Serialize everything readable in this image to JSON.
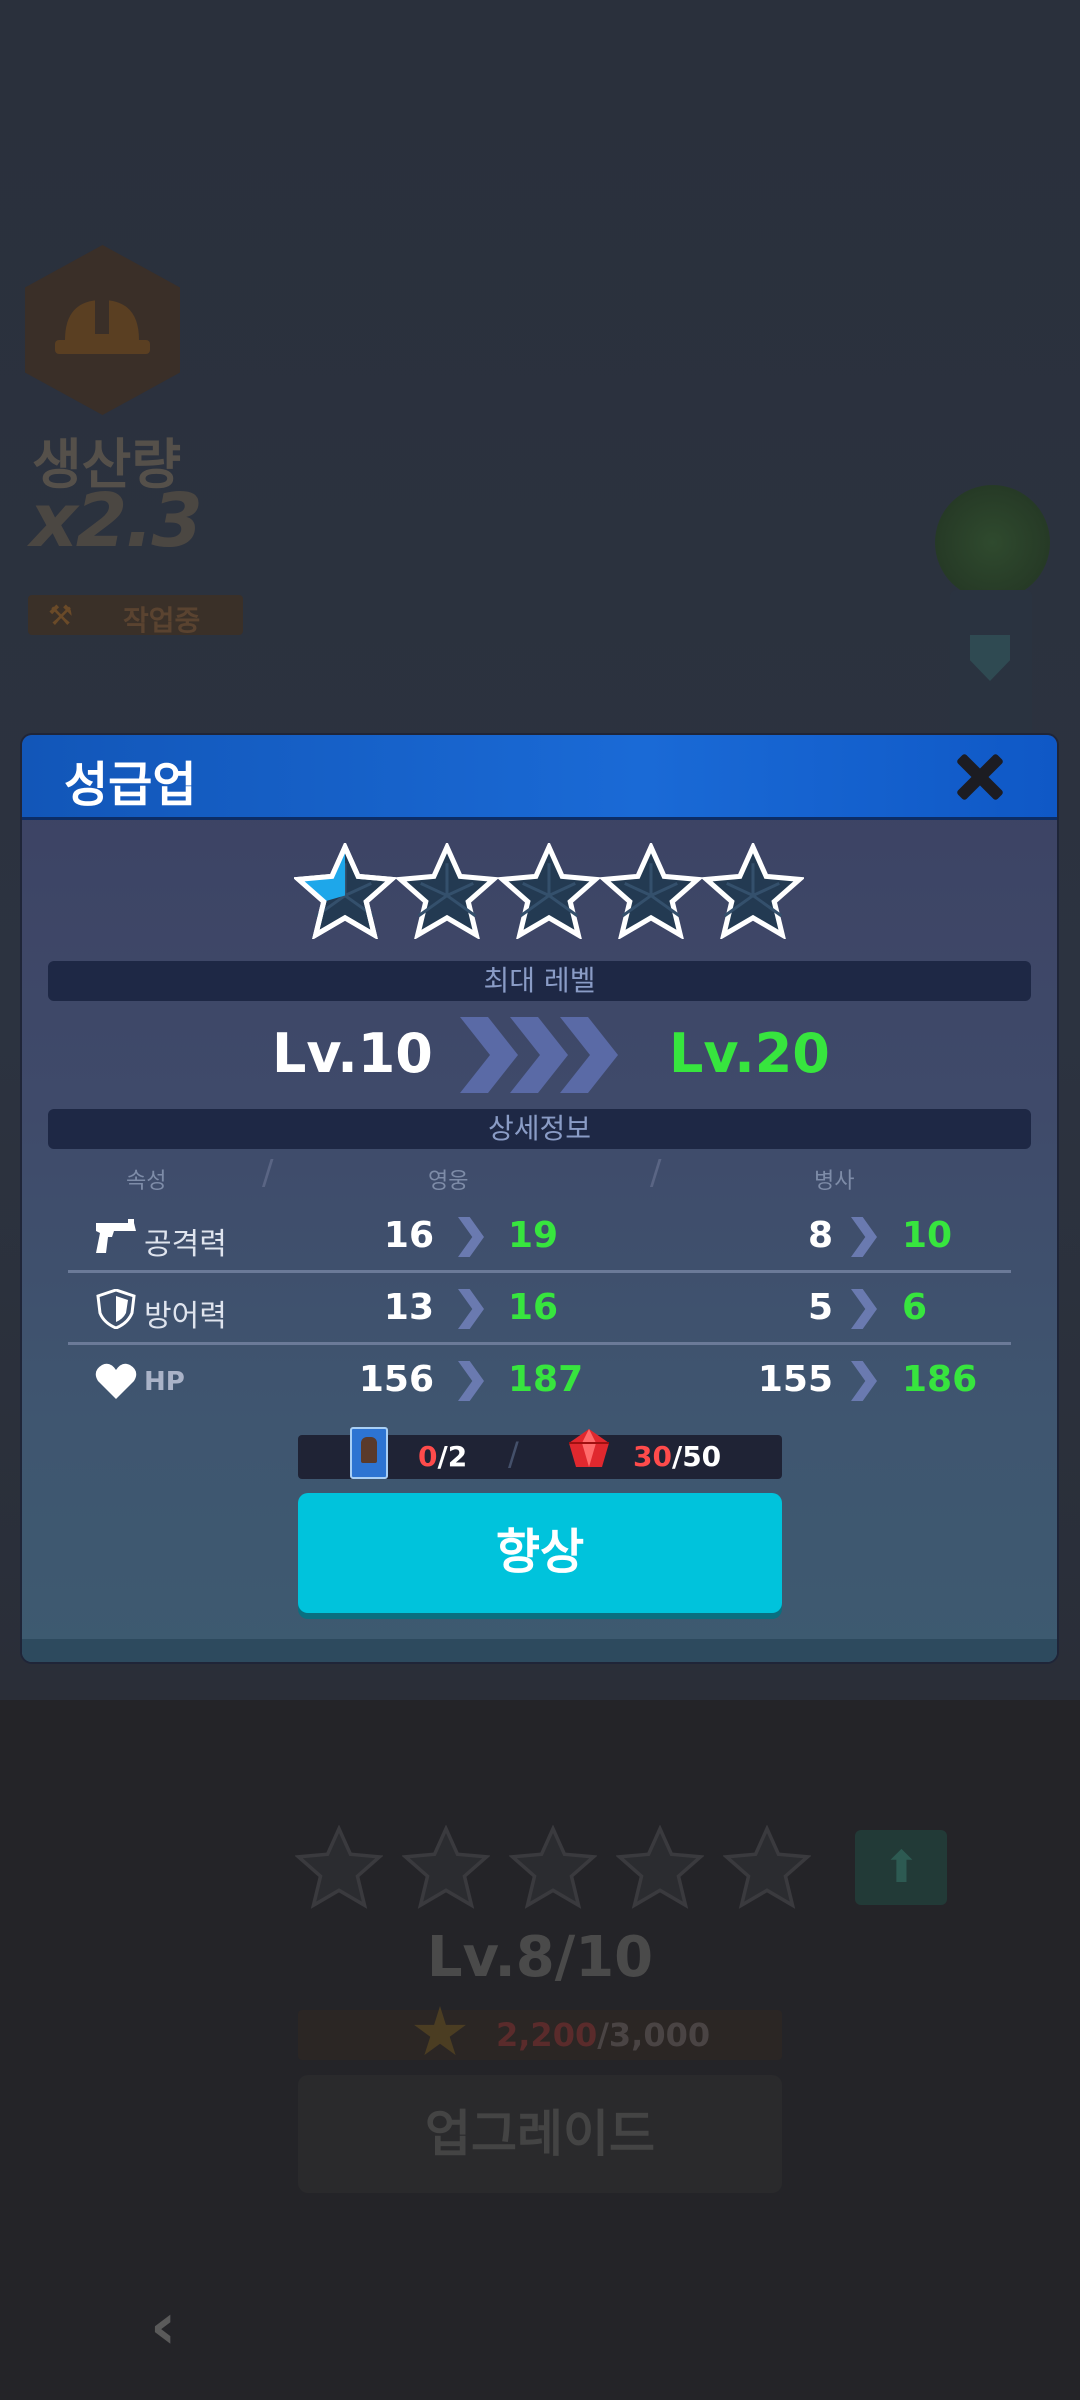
{
  "background": {
    "production_label": "생산량",
    "production_multiplier": "x2.3",
    "work_status": "작업중",
    "level": "Lv.8/10",
    "cost_current": "2,200",
    "cost_total": "/3,000",
    "upgrade_button": "업그레이드",
    "back_icon": "‹",
    "up_arrow_icon": "⬆"
  },
  "dialog": {
    "title": "성급업",
    "close_icon": "close-icon",
    "stars_filled_fraction": 0.5,
    "star_count": 5,
    "max_level_label": "최대 레벨",
    "level_from": "Lv.10",
    "level_to": "Lv.20",
    "details_label": "상세정보",
    "columns": {
      "attribute": "속성",
      "hero": "영웅",
      "soldier": "병사"
    },
    "stats": [
      {
        "name": "공격력",
        "icon": "gun-icon",
        "hero_from": "16",
        "hero_to": "19",
        "soldier_from": "8",
        "soldier_to": "10"
      },
      {
        "name": "방어력",
        "icon": "shield-icon",
        "hero_from": "13",
        "hero_to": "16",
        "soldier_from": "5",
        "soldier_to": "6"
      },
      {
        "name": "HP",
        "icon": "heart-icon",
        "hero_from": "156",
        "hero_to": "187",
        "soldier_from": "155",
        "soldier_to": "186"
      }
    ],
    "cost": {
      "cards_have": "0",
      "cards_need": "/2",
      "gems_have": "30",
      "gems_need": "/50"
    },
    "enhance_button": "향상"
  },
  "colors": {
    "header_blue": "#1a6ad6",
    "enhance_cyan": "#00c3dc",
    "increase_green": "#37e53e",
    "insufficient_red": "#ff4b4b"
  }
}
